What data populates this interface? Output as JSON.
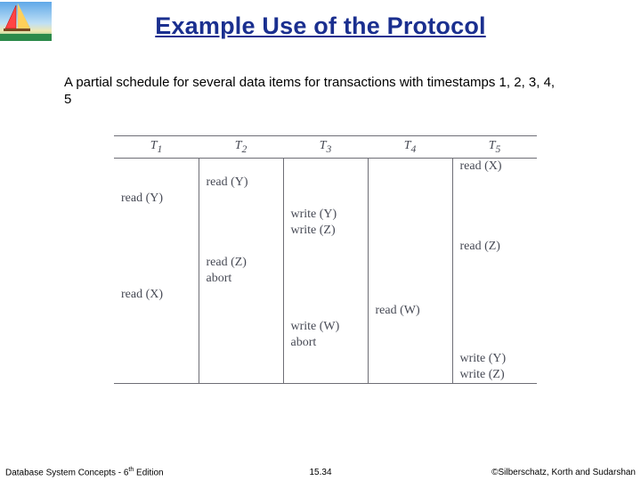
{
  "title": "Example Use of the Protocol",
  "description": "A partial schedule for several data items for transactions with timestamps 1, 2, 3, 4, 5",
  "table": {
    "headers": [
      {
        "base": "T",
        "sub": "1"
      },
      {
        "base": "T",
        "sub": "2"
      },
      {
        "base": "T",
        "sub": "3"
      },
      {
        "base": "T",
        "sub": "4"
      },
      {
        "base": "T",
        "sub": "5"
      }
    ],
    "rows": [
      [
        "",
        "",
        "",
        "",
        "read (X)"
      ],
      [
        "",
        "read (Y)",
        "",
        "",
        ""
      ],
      [
        "read (Y)",
        "",
        "",
        "",
        ""
      ],
      [
        "",
        "",
        "write (Y)",
        "",
        ""
      ],
      [
        "",
        "",
        "write (Z)",
        "",
        ""
      ],
      [
        "",
        "",
        "",
        "",
        "read (Z)"
      ],
      [
        "",
        "read (Z)",
        "",
        "",
        ""
      ],
      [
        "",
        "abort",
        "",
        "",
        ""
      ],
      [
        "read (X)",
        "",
        "",
        "",
        ""
      ],
      [
        "",
        "",
        "",
        "read (W)",
        ""
      ],
      [
        "",
        "",
        "write (W)",
        "",
        ""
      ],
      [
        "",
        "",
        "abort",
        "",
        ""
      ],
      [
        "",
        "",
        "",
        "",
        "write (Y)"
      ],
      [
        "",
        "",
        "",
        "",
        "write (Z)"
      ]
    ]
  },
  "footer": {
    "left_a": "Database System Concepts - 6",
    "left_sup": "th",
    "left_b": " Edition",
    "center": "15.34",
    "right": "©Silberschatz, Korth and Sudarshan"
  }
}
